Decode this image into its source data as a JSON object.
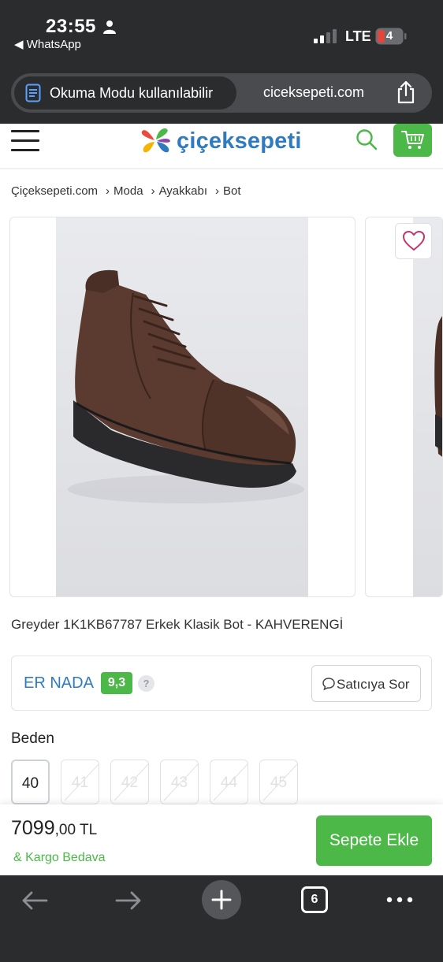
{
  "status_bar": {
    "time": "23:55",
    "back_app": "◀ WhatsApp",
    "network": "LTE",
    "battery": "4"
  },
  "browser": {
    "reader_mode": "Okuma Modu kullanılabilir",
    "url": "ciceksepeti.com",
    "tab_count": "6"
  },
  "header": {
    "logo_text": "çiçeksepeti",
    "brand_color": "#2f7bbf",
    "accent_color": "#4cb847"
  },
  "breadcrumb": [
    {
      "label": "Çiçeksepeti.com"
    },
    {
      "label": "Moda"
    },
    {
      "label": "Ayakkabı"
    },
    {
      "label": "Bot"
    }
  ],
  "product": {
    "title": "Greyder 1K1KB67787 Erkek Klasik Bot - KAHVERENGİ",
    "image": "brown-leather-lace-up-boot"
  },
  "seller": {
    "name": "ER NADA",
    "score": "9,3",
    "help": "?",
    "ask_label": "Satıcıya Sor"
  },
  "sizes": {
    "heading": "Beden",
    "options": [
      {
        "label": "40",
        "available": true
      },
      {
        "label": "41",
        "available": false
      },
      {
        "label": "42",
        "available": false
      },
      {
        "label": "43",
        "available": false
      },
      {
        "label": "44",
        "available": false
      },
      {
        "label": "45",
        "available": false
      }
    ]
  },
  "purchase": {
    "price_main": "7099",
    "price_sub": ",00 TL",
    "cargo": "& Kargo Bedava",
    "add_to_cart": "Sepete Ekle"
  },
  "icons": [
    "person-icon",
    "signal-icon",
    "battery-icon",
    "reader-mode-icon",
    "share-icon",
    "hamburger-menu-icon",
    "logo-flower-icon",
    "search-icon",
    "cart-icon",
    "heart-icon",
    "chat-icon",
    "back-arrow-icon",
    "forward-arrow-icon",
    "plus-icon",
    "tabs-icon",
    "more-icon"
  ]
}
